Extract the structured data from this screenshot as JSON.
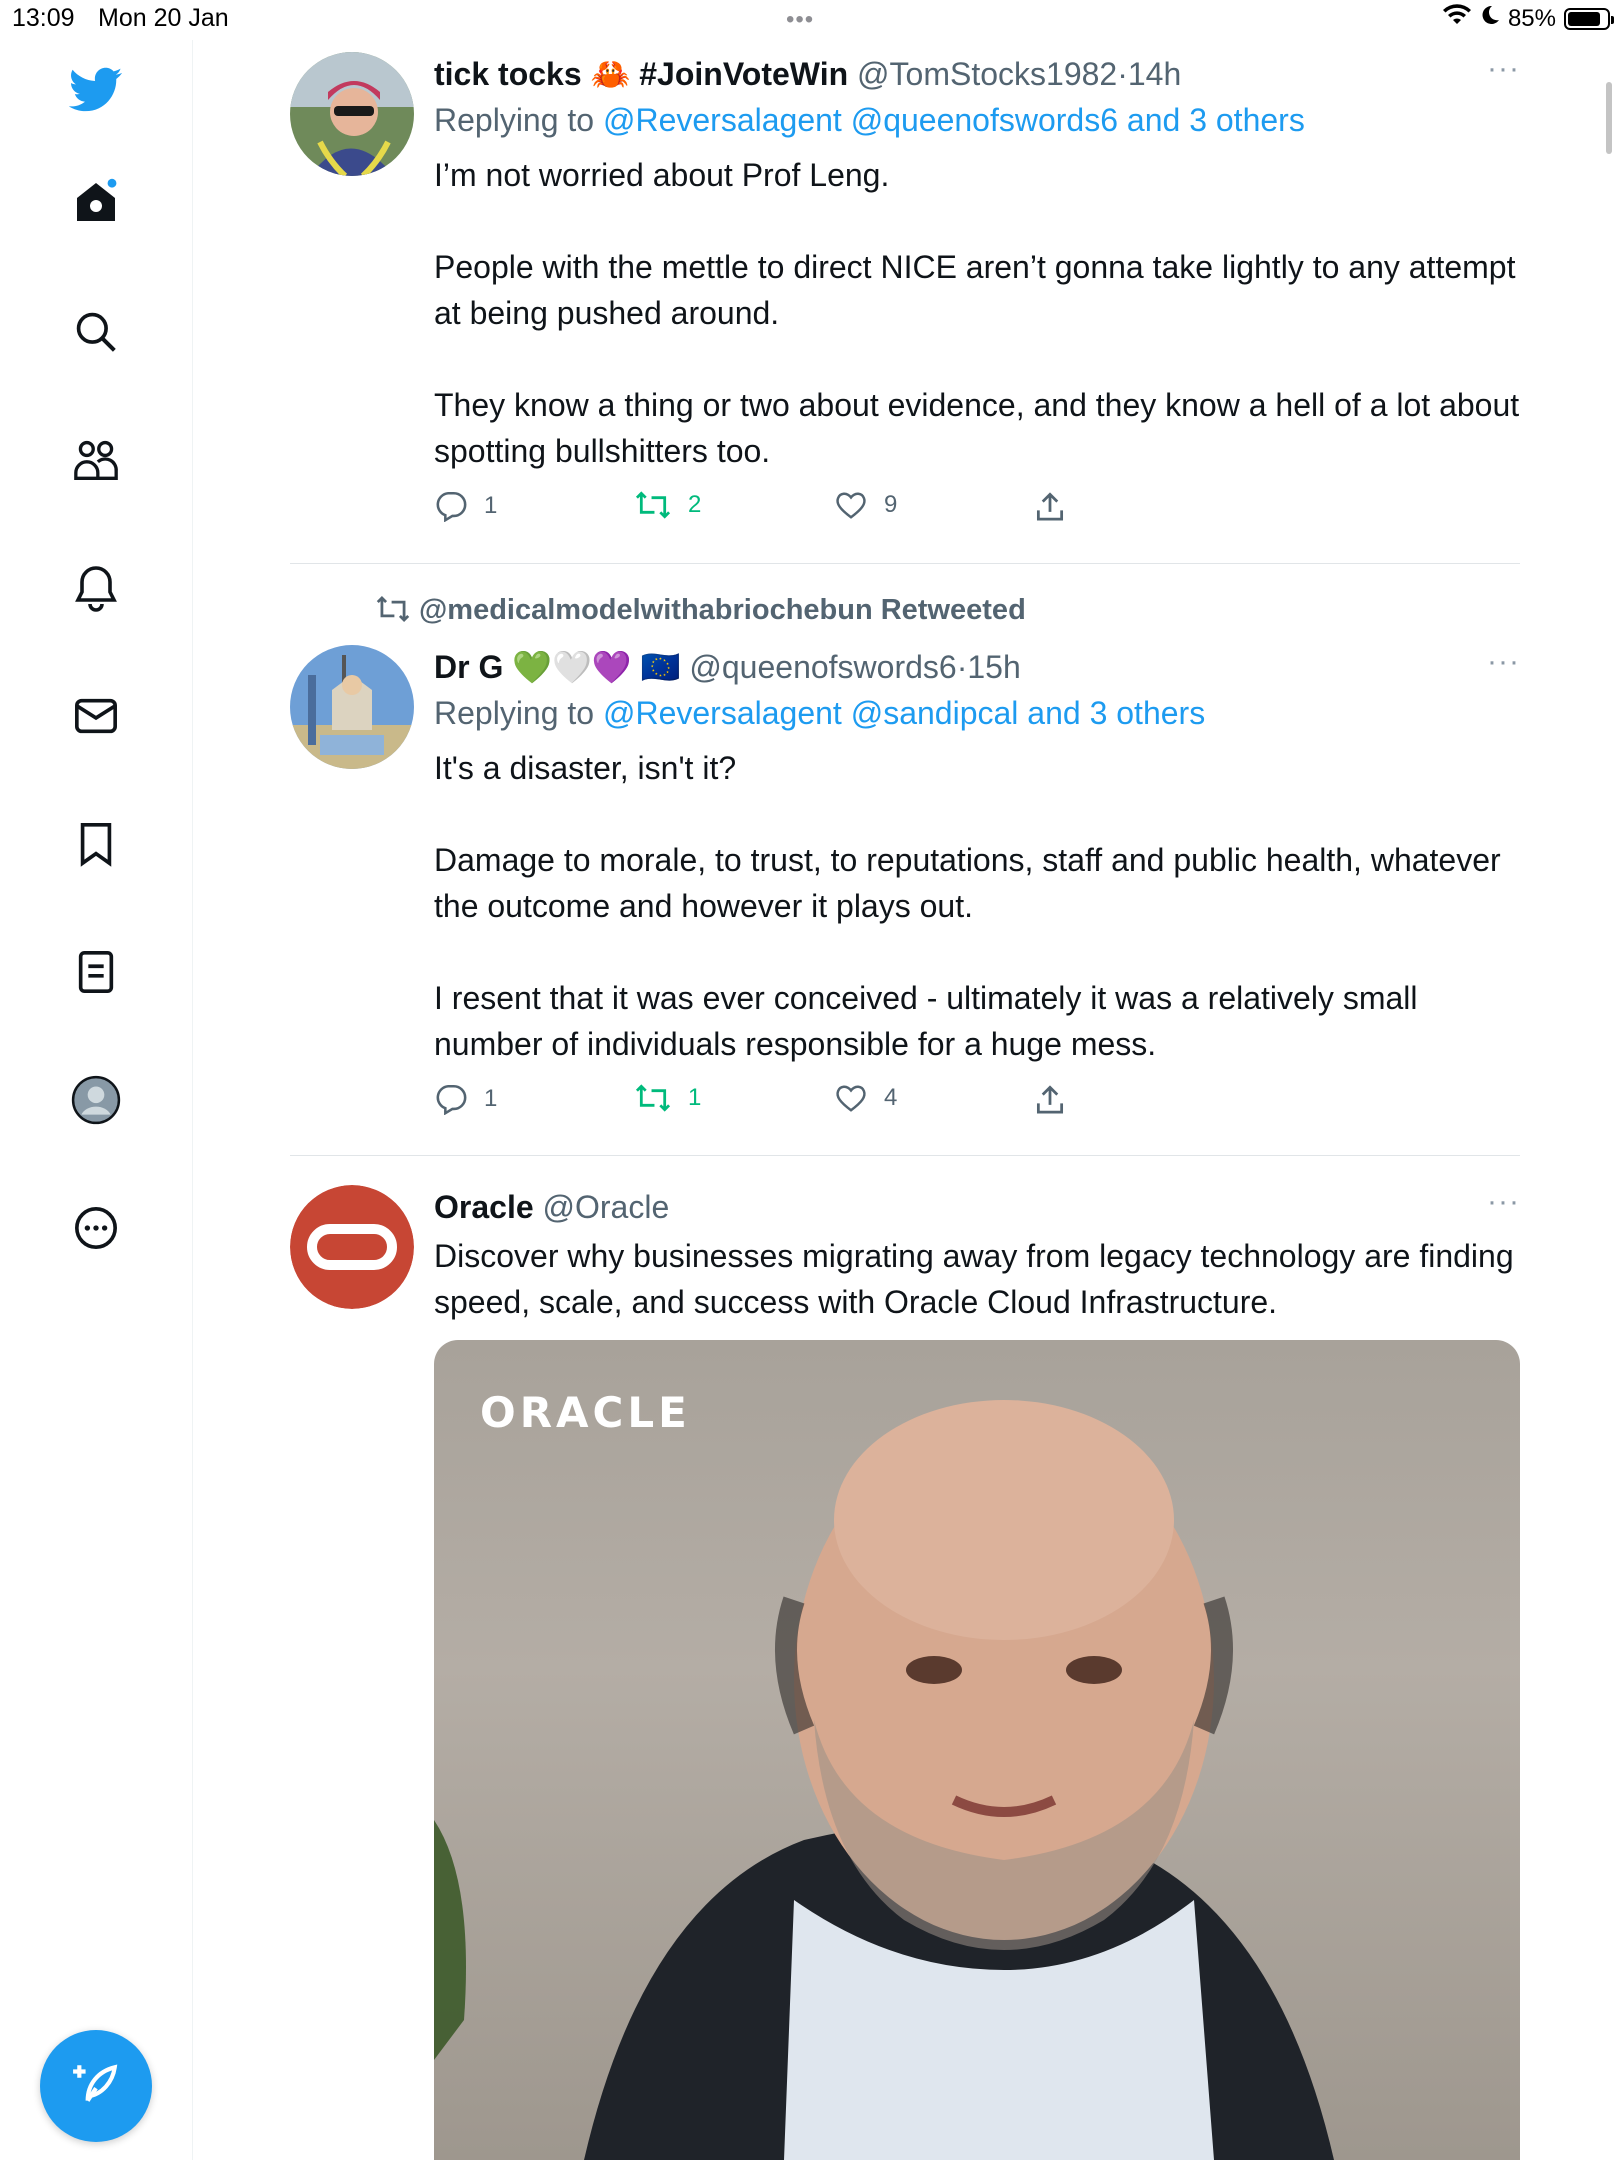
{
  "status_bar": {
    "time": "13:09",
    "date": "Mon 20 Jan",
    "battery_percent": "85%",
    "battery_level": 0.85
  },
  "sidebar": {
    "items": [
      {
        "name": "twitter-logo-icon"
      },
      {
        "name": "home-icon",
        "has_badge": true
      },
      {
        "name": "search-icon"
      },
      {
        "name": "communities-icon"
      },
      {
        "name": "notifications-icon"
      },
      {
        "name": "messages-icon"
      },
      {
        "name": "bookmarks-icon"
      },
      {
        "name": "lists-icon"
      },
      {
        "name": "profile-icon"
      },
      {
        "name": "more-icon"
      }
    ],
    "compose_icon": "compose-icon",
    "accent": "#1d9bf0"
  },
  "tweets": [
    {
      "name": "tick tocks",
      "name_emoji": "🦀",
      "name_tag": "#JoinVoteWin",
      "handle": "@TomStocks1982",
      "sep": "·",
      "time": "14h",
      "replying_prefix": "Replying to",
      "replying_to": "@Reversalagent @queenofswords6 and 3 others",
      "paragraphs": [
        "I’m not worried about Prof Leng.",
        "People with the mettle to direct NICE aren’t gonna take lightly to any attempt at being pushed around.",
        "They know a thing or two about evidence, and they know a hell of a lot about spotting bullshitters too."
      ],
      "replies": "1",
      "retweets": "2",
      "likes": "9"
    },
    {
      "retweeted_by": "@medicalmodelwithabriochebun Retweeted",
      "name": "Dr G",
      "name_emoji": "💚🤍💜",
      "name_flag": "🇪🇺",
      "handle": "@queenofswords6",
      "sep": "·",
      "time": "15h",
      "replying_prefix": "Replying to",
      "replying_to": "@Reversalagent @sandipcal and 3 others",
      "paragraphs": [
        "It's a disaster, isn't it?",
        "Damage to morale, to trust, to reputations, staff and public health, whatever the outcome and however it plays out.",
        "I resent that it was ever conceived - ultimately it was a relatively small number of individuals responsible for a huge mess."
      ],
      "replies": "1",
      "retweets": "1",
      "likes": "4"
    },
    {
      "name": "Oracle",
      "handle": "@Oracle",
      "text": "Discover why businesses migrating away from legacy technology are finding speed, scale, and success with Oracle Cloud Infrastructure.",
      "media_logo": "ORACLE",
      "brand_color": "#c74634"
    }
  ],
  "more_glyph": "···"
}
